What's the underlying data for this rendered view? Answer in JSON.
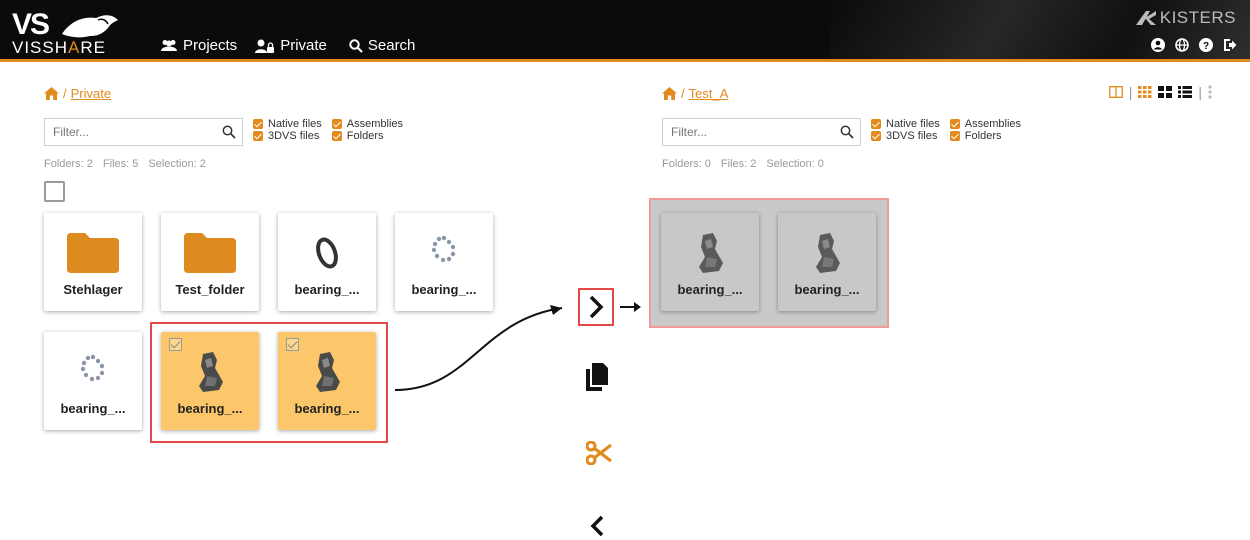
{
  "header": {
    "logo_top": "VS",
    "logo_brand": "VISSHARE",
    "nav": [
      {
        "label": "Projects",
        "icon": "users-icon"
      },
      {
        "label": "Private",
        "icon": "user-lock-icon"
      },
      {
        "label": "Search",
        "icon": "search-icon"
      }
    ],
    "vendor": "KISTERS",
    "right_icons": [
      "account-icon",
      "globe-icon",
      "help-icon",
      "logout-icon"
    ]
  },
  "left_panel": {
    "breadcrumb": {
      "home_icon": "home-icon",
      "sep": "/",
      "folder": "Private"
    },
    "filter_placeholder": "Filter...",
    "checkboxes": [
      "Native files",
      "Assemblies",
      "3DVS files",
      "Folders"
    ],
    "stats": {
      "folders": "Folders: 2",
      "files": "Files: 5",
      "selection": "Selection: 2"
    },
    "tiles": [
      {
        "label": "Stehlager",
        "kind": "folder"
      },
      {
        "label": "Test_folder",
        "kind": "folder"
      },
      {
        "label": "bearing_...",
        "kind": "ring"
      },
      {
        "label": "bearing_...",
        "kind": "balls"
      },
      {
        "label": "bearing_...",
        "kind": "balls"
      },
      {
        "label": "bearing_...",
        "kind": "housing",
        "selected": true
      },
      {
        "label": "bearing_...",
        "kind": "housing",
        "selected": true
      }
    ]
  },
  "right_panel": {
    "breadcrumb": {
      "home_icon": "home-icon",
      "sep": "/",
      "folder": "Test_A"
    },
    "filter_placeholder": "Filter...",
    "checkboxes": [
      "Native files",
      "Assemblies",
      "3DVS files",
      "Folders"
    ],
    "stats": {
      "folders": "Folders: 0",
      "files": "Files: 2",
      "selection": "Selection: 0"
    },
    "tiles": [
      {
        "label": "bearing_...",
        "kind": "housing"
      },
      {
        "label": "bearing_...",
        "kind": "housing"
      }
    ]
  },
  "actions": [
    "move-right-icon",
    "copy-icon",
    "cut-icon",
    "move-left-icon"
  ],
  "colors": {
    "accent": "#e28a1e",
    "highlight": "#e34848",
    "selected_tile": "#fcc76a"
  }
}
